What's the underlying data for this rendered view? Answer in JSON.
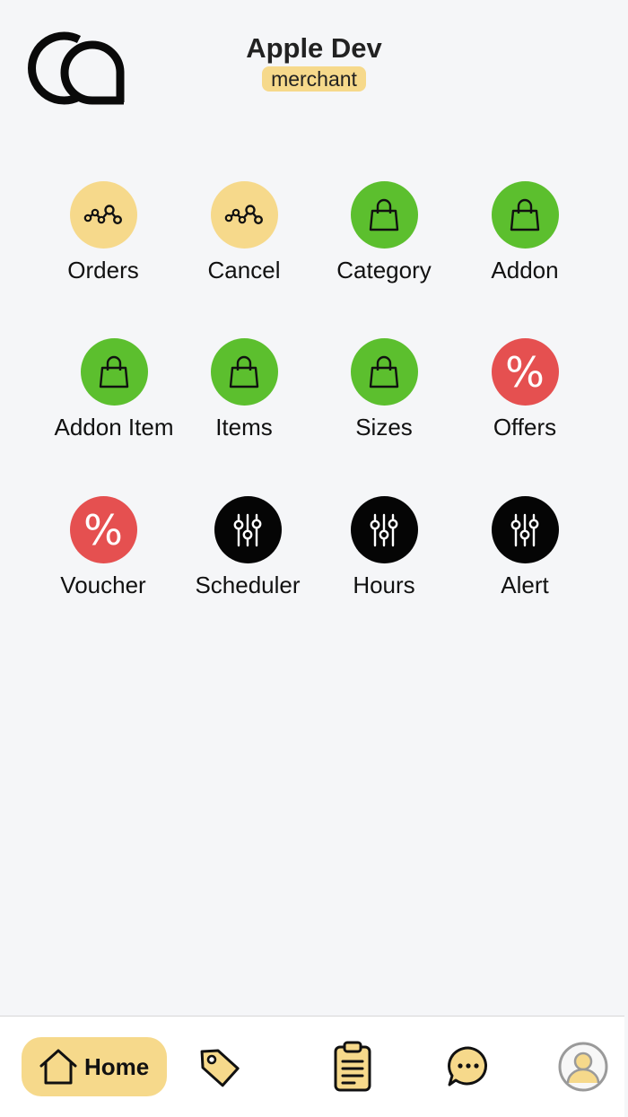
{
  "header": {
    "title": "Apple Dev",
    "role": "merchant",
    "logo": "ca-logo"
  },
  "tiles": [
    {
      "label": "Orders",
      "icon": "route-icon",
      "color": "#f6d98b"
    },
    {
      "label": "Cancel",
      "icon": "route-icon",
      "color": "#f6d98b"
    },
    {
      "label": "Category",
      "icon": "shopping-bag-icon",
      "color": "#5cbf2e"
    },
    {
      "label": "Addon",
      "icon": "shopping-bag-icon",
      "color": "#5cbf2e"
    },
    {
      "label": "Addon Item",
      "icon": "shopping-bag-icon",
      "color": "#5cbf2e"
    },
    {
      "label": "Items",
      "icon": "shopping-bag-icon",
      "color": "#5cbf2e"
    },
    {
      "label": "Sizes",
      "icon": "shopping-bag-icon",
      "color": "#5cbf2e"
    },
    {
      "label": "Offers",
      "icon": "percent-icon",
      "color": "#e55050"
    },
    {
      "label": "Voucher",
      "icon": "percent-icon",
      "color": "#e55050"
    },
    {
      "label": "Scheduler",
      "icon": "sliders-icon",
      "color": "#050505"
    },
    {
      "label": "Hours",
      "icon": "sliders-icon",
      "color": "#050505"
    },
    {
      "label": "Alert",
      "icon": "sliders-icon",
      "color": "#050505"
    }
  ],
  "percent_symbol": "%",
  "bottom_nav": {
    "home_label": "Home",
    "items": [
      "home-icon",
      "tag-icon",
      "clipboard-icon",
      "chat-icon",
      "profile-icon"
    ],
    "active": "Home",
    "accent": "#f6d98b"
  }
}
